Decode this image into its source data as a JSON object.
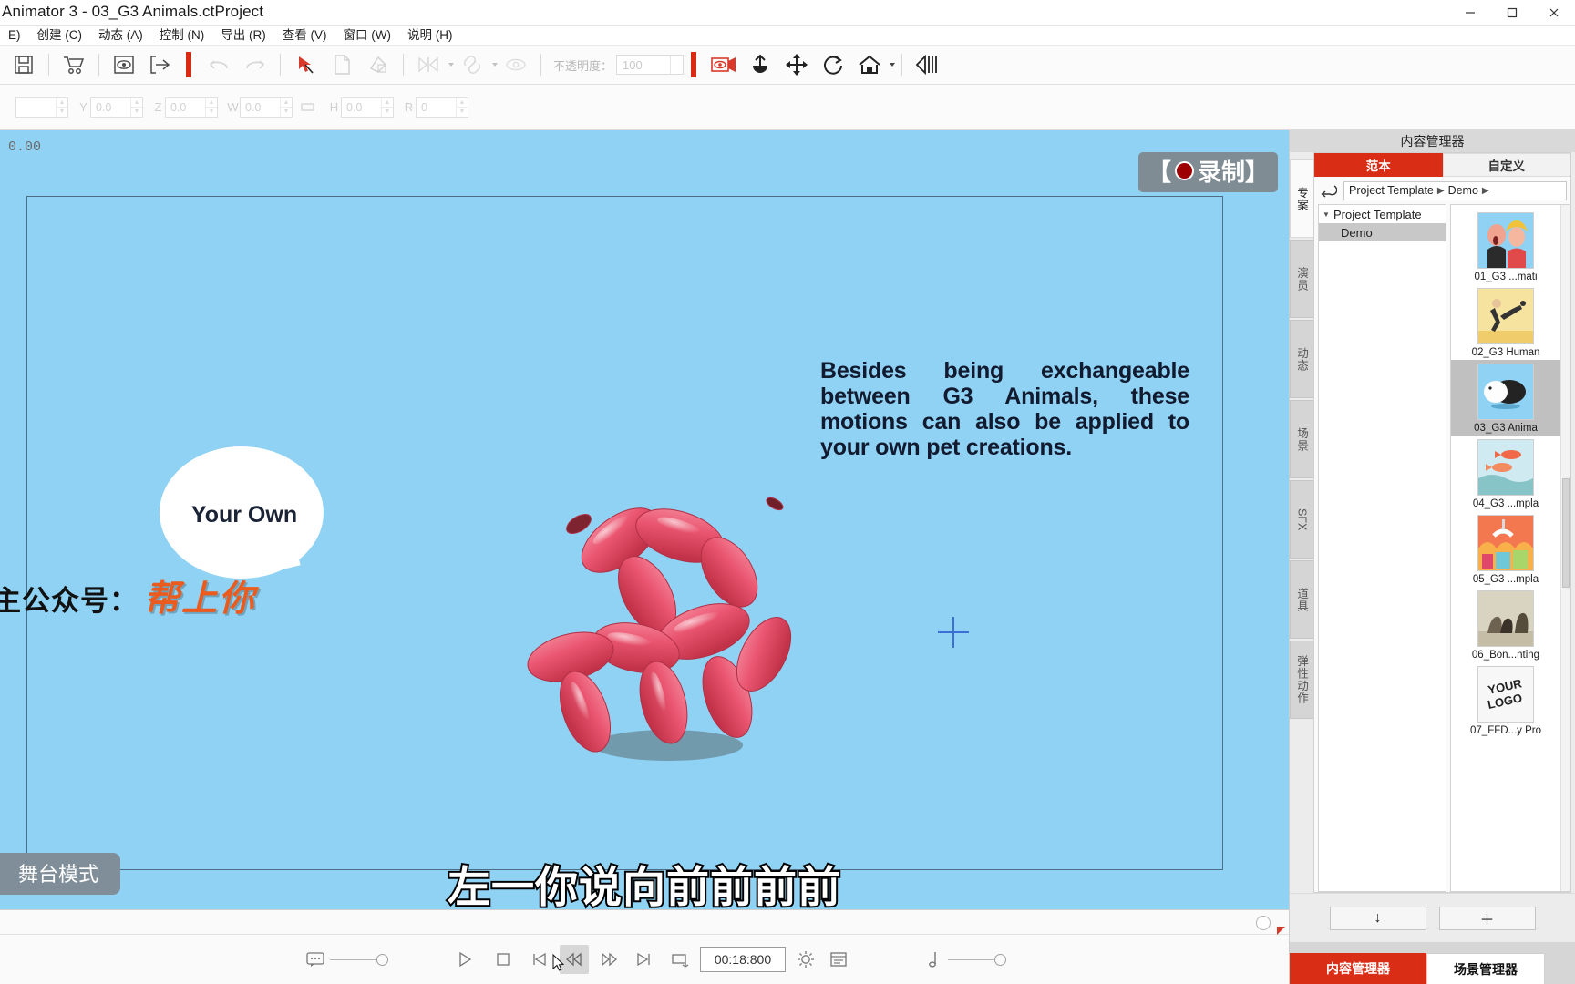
{
  "window": {
    "title": "Animator 3 - 03_G3 Animals.ctProject",
    "minimize": "─",
    "maximize": "☐",
    "close": "✕"
  },
  "menubar": {
    "items": [
      {
        "label": "E)",
        "accel": ""
      },
      {
        "label": "创建 (C)",
        "accel": "C"
      },
      {
        "label": "动态 (A)",
        "accel": "A"
      },
      {
        "label": "控制 (N)",
        "accel": "N"
      },
      {
        "label": "导出 (R)",
        "accel": "R"
      },
      {
        "label": "查看 (V)",
        "accel": "V"
      },
      {
        "label": "窗口 (W)",
        "accel": "W"
      },
      {
        "label": "说明 (H)",
        "accel": "H"
      }
    ]
  },
  "toolbar": {
    "opacity_label": "不透明度：",
    "opacity_value": "100",
    "icons": [
      "save-icon",
      "cart-icon",
      "preview-eye-icon",
      "export-icon",
      "undo-icon",
      "redo-icon",
      "select-arrow-icon",
      "copy-icon",
      "paste-style-icon",
      "align-icon",
      "link-icon",
      "visibility-icon",
      "record-face-icon",
      "anchor-icon",
      "move-icon",
      "rotate-icon",
      "home-icon",
      "flip-icon"
    ]
  },
  "propbar": {
    "fields": [
      {
        "label": "",
        "value": ""
      },
      {
        "label": "Y",
        "value": "0.0"
      },
      {
        "label": "Z",
        "value": "0.0"
      },
      {
        "label": "W",
        "value": "0.0"
      },
      {
        "label": "H",
        "value": "0.0"
      },
      {
        "label": "R",
        "value": "0"
      }
    ]
  },
  "stage": {
    "time": "0.00",
    "record_badge": "录制",
    "record_bracket_left": "【",
    "record_bracket_right": "】",
    "paragraph": "Besides being exchangeable between G3 Animals, these motions can also be applied to your own pet creations.",
    "bubble_text": "Your Own",
    "watermark_prefix": "主公众号：",
    "watermark_brand": "帮上你",
    "mode_badge": "舞台模式",
    "caption": "左一你说向前前前前",
    "background_color": "#8fd2f4"
  },
  "player": {
    "timecode": "00:18:800",
    "controls": [
      {
        "name": "caption-toggle-icon",
        "glyph": "speech"
      },
      {
        "name": "play-button",
        "glyph": "play"
      },
      {
        "name": "stop-button",
        "glyph": "stop"
      },
      {
        "name": "prev-frame-button",
        "glyph": "prev"
      },
      {
        "name": "rewind-button",
        "glyph": "rewind"
      },
      {
        "name": "fast-forward-button",
        "glyph": "ff"
      },
      {
        "name": "next-frame-button",
        "glyph": "next"
      },
      {
        "name": "loop-button",
        "glyph": "loop"
      },
      {
        "name": "render-quality-button",
        "glyph": "gear"
      },
      {
        "name": "timeline-list-button",
        "glyph": "list"
      },
      {
        "name": "audio-volume-slider",
        "glyph": "note"
      }
    ]
  },
  "content_manager": {
    "panel_title": "内容管理器",
    "vertical_tabs": [
      {
        "label": "专案",
        "active": true,
        "latin": false
      },
      {
        "label": "演员",
        "active": false,
        "latin": false
      },
      {
        "label": "动态",
        "active": false,
        "latin": false
      },
      {
        "label": "场景",
        "active": false,
        "latin": false
      },
      {
        "label": "SFX",
        "active": false,
        "latin": true
      },
      {
        "label": "道具",
        "active": false,
        "latin": false
      },
      {
        "label": "弹性动作",
        "active": false,
        "latin": false
      }
    ],
    "tabs": [
      {
        "label": "范本",
        "active": true
      },
      {
        "label": "自定义",
        "active": false
      }
    ],
    "back_icon": "back-arrow-icon",
    "breadcrumb": [
      "Project Template",
      "Demo"
    ],
    "tree": [
      {
        "label": "Project Template",
        "level": 0,
        "selected": false,
        "expanded": true
      },
      {
        "label": "Demo",
        "level": 1,
        "selected": true,
        "expanded": false
      }
    ],
    "items": [
      {
        "label": "01_G3 ...mati",
        "selected": false,
        "thumb": "two-characters"
      },
      {
        "label": "02_G3 Human",
        "selected": false,
        "thumb": "kicking-man"
      },
      {
        "label": "03_G3 Anima",
        "selected": true,
        "thumb": "guinea-pig"
      },
      {
        "label": "04_G3 ...mpla",
        "selected": false,
        "thumb": "fish"
      },
      {
        "label": "05_G3 ...mpla",
        "selected": false,
        "thumb": "gifts"
      },
      {
        "label": "06_Bon...nting",
        "selected": false,
        "thumb": "painting"
      },
      {
        "label": "07_FFD...y Pro",
        "selected": false,
        "thumb": "your-logo"
      }
    ],
    "footer_buttons": [
      {
        "label": "↓",
        "name": "download-button"
      },
      {
        "label": "＋",
        "name": "add-button"
      }
    ],
    "bottom_tabs": [
      {
        "label": "内容管理器",
        "active": true
      },
      {
        "label": "场景管理器",
        "active": false
      }
    ]
  },
  "colors": {
    "accent_red": "#da2d16",
    "stage_blue": "#8fd2f4",
    "brand_orange": "#eb5b1e"
  }
}
